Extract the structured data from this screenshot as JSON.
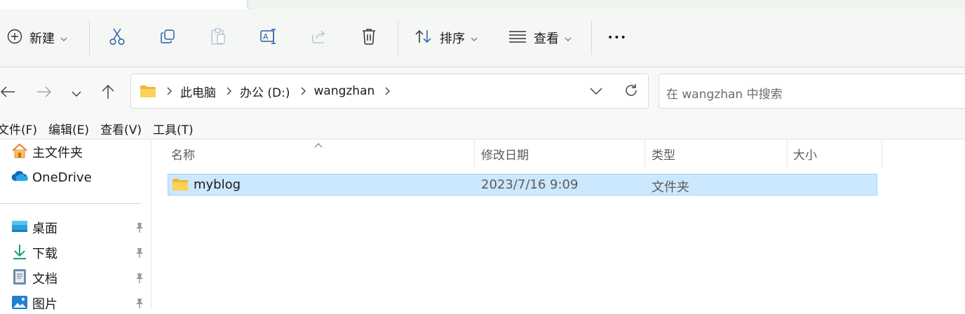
{
  "toolbar": {
    "new_label": "新建",
    "sort_label": "排序",
    "view_label": "查看",
    "more_label": "•••"
  },
  "address": {
    "crumbs": [
      "此电脑",
      "办公 (D:)",
      "wangzhan"
    ],
    "search_placeholder": "在 wangzhan 中搜索"
  },
  "menubar": {
    "items": [
      "文件(F)",
      "编辑(E)",
      "查看(V)",
      "工具(T)"
    ]
  },
  "sidebar": {
    "items": [
      {
        "label": "主文件夹",
        "icon": "home-icon"
      },
      {
        "label": "OneDrive",
        "icon": "cloud-icon"
      },
      {
        "label": "桌面",
        "icon": "desktop-icon",
        "pinned": true
      },
      {
        "label": "下载",
        "icon": "download-icon",
        "pinned": true
      },
      {
        "label": "文档",
        "icon": "document-icon",
        "pinned": true
      },
      {
        "label": "图片",
        "icon": "pictures-icon",
        "pinned": true
      }
    ]
  },
  "columns": {
    "name": "名称",
    "modified": "修改日期",
    "type": "类型",
    "size": "大小"
  },
  "files": [
    {
      "name": "myblog",
      "modified": "2023/7/16 9:09",
      "type": "文件夹",
      "size": ""
    }
  ],
  "colors": {
    "selection_bg": "#cce8ff",
    "selection_border": "#99d1ff",
    "folder_yellow": "#f8c83c",
    "accent_blue": "#0067c0"
  }
}
